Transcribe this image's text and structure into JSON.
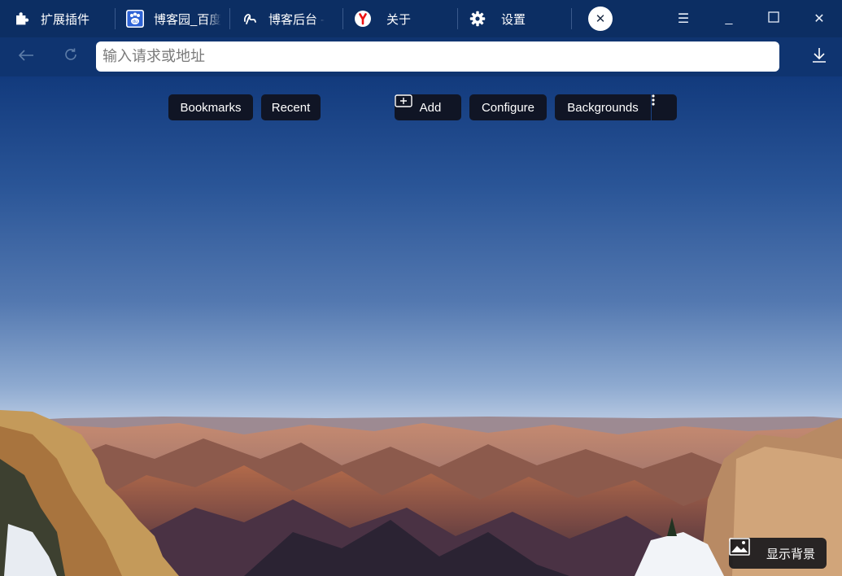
{
  "tabs": [
    {
      "label": "扩展插件",
      "icon": "puzzle-icon"
    },
    {
      "label": "博客园_百度",
      "icon": "baidu-paw-icon"
    },
    {
      "label": "博客后台 - ",
      "icon": "cnblogs-logo-icon"
    },
    {
      "label": "关于",
      "icon": "yandex-icon"
    },
    {
      "label": "设置",
      "icon": "gear-icon"
    }
  ],
  "window_controls": {
    "menu": "☰",
    "minimize": "_",
    "maximize": "☐",
    "close": "✕"
  },
  "address": {
    "placeholder": "输入请求或地址",
    "value": ""
  },
  "toolbar": {
    "bookmarks": "Bookmarks",
    "recent": "Recent",
    "add": "Add",
    "configure": "Configure",
    "backgrounds": "Backgrounds"
  },
  "show_background": "显示背景",
  "colors": {
    "tabbar": "#0c2e63",
    "navbar": "#0f3470",
    "pill": "#101525"
  }
}
